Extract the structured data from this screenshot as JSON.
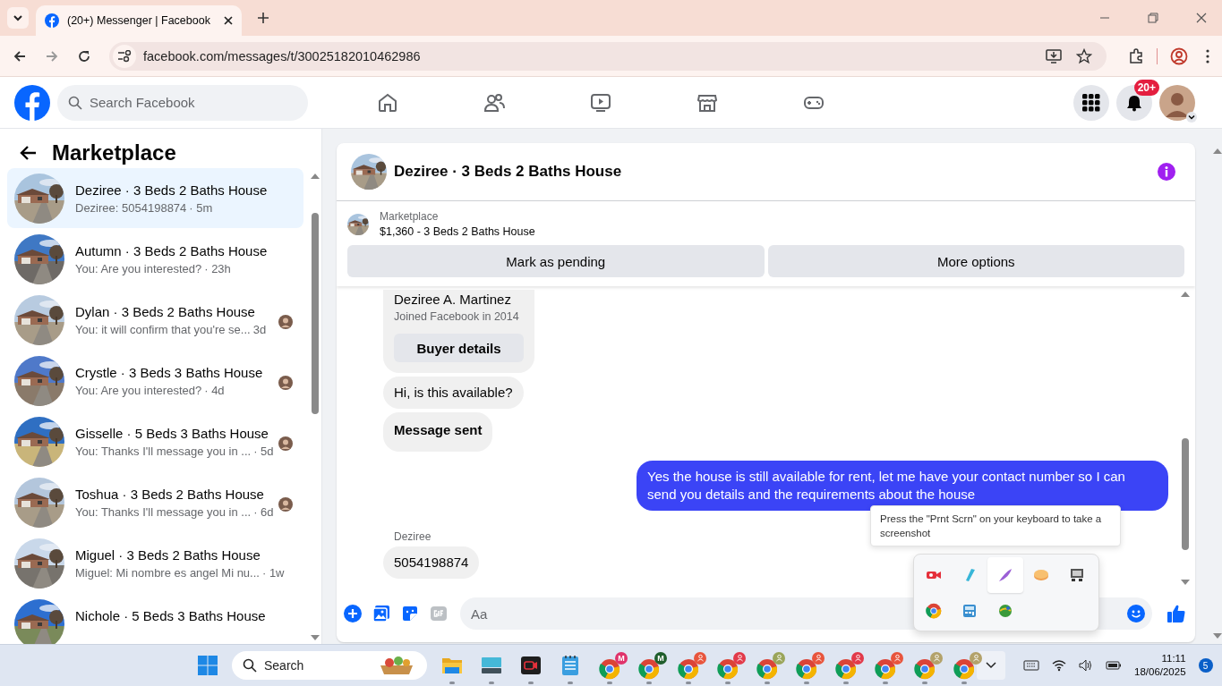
{
  "browser": {
    "tab_title": "(20+) Messenger | Facebook",
    "url": "facebook.com/messages/t/30025182010462986"
  },
  "topbar": {
    "search_placeholder": "Search Facebook",
    "nav": [
      {
        "kind": "home"
      },
      {
        "kind": "friends"
      },
      {
        "kind": "video"
      },
      {
        "kind": "marketplace"
      },
      {
        "kind": "gaming"
      }
    ],
    "notifications_badge": "20+"
  },
  "sidebar": {
    "title": "Marketplace",
    "conversations": [
      {
        "title": "Deziree · 3 Beds 2 Baths House",
        "preview": "Deziree: 5054198874",
        "time": "· 5m",
        "selected": true,
        "seen": false
      },
      {
        "title": "Autumn · 3 Beds 2 Baths House",
        "preview": "You: Are you interested?",
        "time": "· 23h",
        "selected": false,
        "seen": false
      },
      {
        "title": "Dylan · 3 Beds 2 Baths House",
        "preview": "You: it will confirm that you're se...",
        "time": "3d",
        "selected": false,
        "seen": true
      },
      {
        "title": "Crystle · 3 Beds 3 Baths House",
        "preview": "You: Are you interested?",
        "time": "· 4d",
        "selected": false,
        "seen": true
      },
      {
        "title": "Gisselle · 5 Beds 3 Baths House",
        "preview": "You: Thanks I'll message you in ...",
        "time": "· 5d",
        "selected": false,
        "seen": true
      },
      {
        "title": "Toshua · 3 Beds 2 Baths House",
        "preview": "You: Thanks I'll message you in ...",
        "time": "· 6d",
        "selected": false,
        "seen": true
      },
      {
        "title": "Miguel · 3 Beds 2 Baths House",
        "preview": "Miguel: Mi nombre es angel Mi nu...",
        "time": "· 1w",
        "selected": false,
        "seen": false
      },
      {
        "title": "Nichole · 5 Beds 3 Baths House",
        "selected": false,
        "seen": false
      }
    ]
  },
  "chat": {
    "title": "Deziree · 3 Beds 2 Baths House",
    "listing": {
      "label": "Marketplace",
      "summary": "$1,360 - 3 Beds 2 Baths House",
      "buttons": [
        "Mark as pending",
        "More options"
      ]
    },
    "messages": [
      {
        "kind": "profile_card",
        "name": "Deziree A. Martinez",
        "joined": "Joined Facebook in 2014",
        "button": "Buyer details"
      },
      {
        "kind": "incoming",
        "text": "Hi, is this available?"
      },
      {
        "kind": "notice",
        "text": "Message sent"
      },
      {
        "kind": "outgoing",
        "text": "Yes the house is still available for rent, let me have your contact number so I can send you details and the requirements about the house"
      },
      {
        "kind": "incoming",
        "sender": "Deziree",
        "text": "5054198874"
      }
    ],
    "composer_placeholder": "Aa"
  },
  "tooltip": "Press the \"Prnt Scrn\" on your keyboard to take a screenshot",
  "tray_popup": [
    {
      "kind": "recorder",
      "hovered": false
    },
    {
      "kind": "pen",
      "hovered": false
    },
    {
      "kind": "feather",
      "hovered": true
    },
    {
      "kind": "disc",
      "hovered": false
    },
    {
      "kind": "device",
      "hovered": false
    },
    {
      "kind": "chrome",
      "hovered": false
    },
    {
      "kind": "calculator",
      "hovered": false
    },
    {
      "kind": "globe",
      "hovered": false
    }
  ],
  "taskbar": {
    "search_placeholder": "Search",
    "apps": [
      {
        "kind": "explorer"
      },
      {
        "kind": "keyboard"
      },
      {
        "kind": "recorder"
      },
      {
        "kind": "notepad"
      },
      {
        "kind": "chrome",
        "badge": "M",
        "color": "#e0336b"
      },
      {
        "kind": "chrome",
        "badge": "M",
        "color": "#1f5e2c"
      },
      {
        "kind": "chrome",
        "color": "#e8553d"
      },
      {
        "kind": "chrome",
        "color": "#e23a4a"
      },
      {
        "kind": "chrome",
        "color": "#9aa55a"
      },
      {
        "kind": "chrome",
        "color": "#e8553d"
      },
      {
        "kind": "chrome",
        "color": "#e23a4a"
      },
      {
        "kind": "chrome",
        "color": "#e8553d"
      },
      {
        "kind": "chrome",
        "color": "#b3a26a"
      },
      {
        "kind": "chrome",
        "color": "#b3a26a"
      }
    ],
    "time": "11:11",
    "date": "18/06/2025",
    "notifications": "5"
  }
}
